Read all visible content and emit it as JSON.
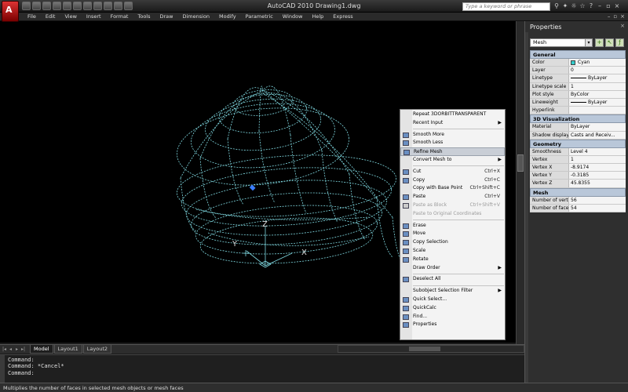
{
  "window": {
    "title": "AutoCAD 2010    Drawing1.dwg",
    "app_logo_letter": "A"
  },
  "help_search": {
    "placeholder": "Type a keyword or phrase"
  },
  "menus": [
    "File",
    "Edit",
    "View",
    "Insert",
    "Format",
    "Tools",
    "Draw",
    "Dimension",
    "Modify",
    "Parametric",
    "Window",
    "Help",
    "Express"
  ],
  "layout_tabs": [
    {
      "label": "Model",
      "active": true
    },
    {
      "label": "Layout1",
      "active": false
    },
    {
      "label": "Layout2",
      "active": false
    }
  ],
  "command_lines": [
    "Command:",
    "Command: *Cancel*",
    "Command:"
  ],
  "status_text": "Multiplies the number of faces in selected mesh objects or mesh faces",
  "ucs_labels": {
    "x": "X",
    "y": "Y",
    "z": "Z"
  },
  "properties": {
    "title": "Properties",
    "close": "×",
    "selection": "Mesh",
    "sections": [
      {
        "title": "General",
        "rows": [
          {
            "key": "Color",
            "value": "Cyan",
            "swatch": "#33cccc"
          },
          {
            "key": "Layer",
            "value": "0"
          },
          {
            "key": "Linetype",
            "value": "ByLayer",
            "line": true
          },
          {
            "key": "Linetype scale",
            "value": "1"
          },
          {
            "key": "Plot style",
            "value": "ByColor"
          },
          {
            "key": "Lineweight",
            "value": "ByLayer",
            "line": true
          },
          {
            "key": "Hyperlink",
            "value": ""
          }
        ]
      },
      {
        "title": "3D Visualization",
        "rows": [
          {
            "key": "Material",
            "value": "ByLayer"
          },
          {
            "key": "Shadow display",
            "value": "Casts and Receiv..."
          }
        ]
      },
      {
        "title": "Geometry",
        "rows": [
          {
            "key": "Smoothness",
            "value": "Level 4"
          },
          {
            "key": "Vertex",
            "value": "1"
          },
          {
            "key": "Vertex X",
            "value": "-8.9174"
          },
          {
            "key": "Vertex Y",
            "value": "-0.3185"
          },
          {
            "key": "Vertex Z",
            "value": "45.8355"
          }
        ]
      },
      {
        "title": "Mesh",
        "rows": [
          {
            "key": "Number of vert...",
            "value": "56"
          },
          {
            "key": "Number of faces",
            "value": "54"
          }
        ]
      }
    ]
  },
  "context_menu": [
    {
      "label": "Repeat 3DORBITTRANSPARENT"
    },
    {
      "label": "Recent Input",
      "submenu": true
    },
    {
      "sep": true
    },
    {
      "label": "Smooth More",
      "icon": "smooth-more-icon"
    },
    {
      "label": "Smooth Less",
      "icon": "smooth-less-icon"
    },
    {
      "label": "Refine Mesh",
      "icon": "refine-mesh-icon",
      "highlight": true
    },
    {
      "label": "Convert Mesh to",
      "submenu": true
    },
    {
      "sep": true
    },
    {
      "label": "Cut",
      "shortcut": "Ctrl+X",
      "icon": "cut-icon"
    },
    {
      "label": "Copy",
      "shortcut": "Ctrl+C",
      "icon": "copy-icon"
    },
    {
      "label": "Copy with Base Point",
      "shortcut": "Ctrl+Shift+C"
    },
    {
      "label": "Paste",
      "shortcut": "Ctrl+V",
      "icon": "paste-icon"
    },
    {
      "label": "Paste as Block",
      "shortcut": "Ctrl+Shift+V",
      "disabled": true,
      "icon": "paste-block-icon"
    },
    {
      "label": "Paste to Original Coordinates",
      "disabled": true
    },
    {
      "sep": true
    },
    {
      "label": "Erase",
      "icon": "erase-icon"
    },
    {
      "label": "Move",
      "icon": "move-icon"
    },
    {
      "label": "Copy Selection",
      "icon": "copy-selection-icon"
    },
    {
      "label": "Scale",
      "icon": "scale-icon"
    },
    {
      "label": "Rotate",
      "icon": "rotate-icon"
    },
    {
      "label": "Draw Order",
      "submenu": true
    },
    {
      "sep": true
    },
    {
      "label": "Deselect All",
      "icon": "deselect-icon"
    },
    {
      "sep": true
    },
    {
      "label": "Subobject Selection Filter",
      "submenu": true
    },
    {
      "label": "Quick Select...",
      "icon": "quick-select-icon"
    },
    {
      "label": "QuickCalc",
      "icon": "quickcalc-icon"
    },
    {
      "label": "Find...",
      "icon": "find-icon"
    },
    {
      "label": "Properties",
      "icon": "properties-icon"
    }
  ],
  "colors": {
    "wire": "#7fd8e0",
    "highlight": "#c9ced6",
    "section": "#b9c7d9"
  }
}
